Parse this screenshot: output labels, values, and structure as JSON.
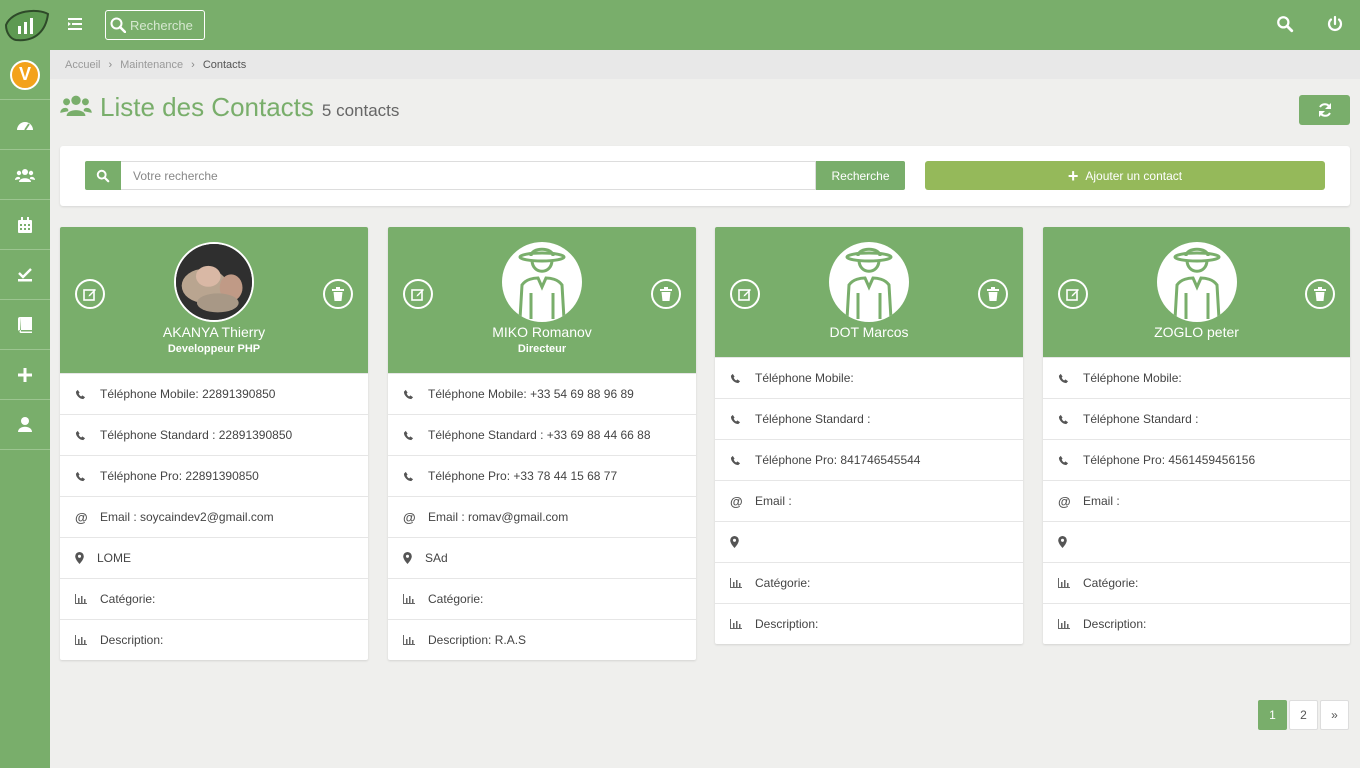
{
  "topbar": {
    "search_placeholder": "Recherche",
    "icons": [
      "menu-icon",
      "search-icon",
      "power-icon"
    ]
  },
  "sidebar": {
    "items": [
      {
        "icon": "logo-v-icon",
        "label": "V"
      },
      {
        "icon": "dashboard-icon"
      },
      {
        "icon": "users-icon"
      },
      {
        "icon": "calendar-icon"
      },
      {
        "icon": "tasks-icon"
      },
      {
        "icon": "book-icon"
      },
      {
        "icon": "plus-icon"
      },
      {
        "icon": "user-icon"
      }
    ]
  },
  "breadcrumb": {
    "items": [
      "Accueil",
      "Maintenance",
      "Contacts"
    ]
  },
  "page": {
    "title": "Liste des Contacts",
    "count": "5 contacts"
  },
  "search": {
    "placeholder": "Votre recherche",
    "button": "Recherche",
    "add_button": "Ajouter un contact"
  },
  "contacts": [
    {
      "name": "AKANYA Thierry",
      "role": "Developpeur PHP",
      "avatar": "photo",
      "mobile": "Téléphone Mobile: 22891390850",
      "standard": "Téléphone Standard : 22891390850",
      "pro": "Téléphone Pro: 22891390850",
      "email": "Email : soycaindev2@gmail.com",
      "location": "LOME",
      "category": "Catégorie:",
      "description": "Description:"
    },
    {
      "name": "MIKO Romanov",
      "role": "Directeur",
      "avatar": "placeholder",
      "mobile": "Téléphone Mobile: +33 54 69 88 96 89",
      "standard": "Téléphone Standard : +33 69 88 44 66 88",
      "pro": "Téléphone Pro: +33 78 44 15 68 77",
      "email": "Email : romav@gmail.com",
      "location": "SAd",
      "category": "Catégorie:",
      "description": "Description: R.A.S"
    },
    {
      "name": "DOT Marcos",
      "role": "",
      "avatar": "placeholder",
      "mobile": "Téléphone Mobile:",
      "standard": "Téléphone Standard :",
      "pro": "Téléphone Pro: 841746545544",
      "email": "Email :",
      "location": "",
      "category": "Catégorie:",
      "description": "Description:"
    },
    {
      "name": "ZOGLO peter",
      "role": "",
      "avatar": "placeholder",
      "mobile": "Téléphone Mobile:",
      "standard": "Téléphone Standard :",
      "pro": "Téléphone Pro: 4561459456156",
      "email": "Email :",
      "location": "",
      "category": "Catégorie:",
      "description": "Description:"
    }
  ],
  "pagination": {
    "pages": [
      "1",
      "2"
    ],
    "next": "»",
    "current": "1"
  },
  "colors": {
    "primary": "#79ae6b",
    "add_button": "#95b95a",
    "logo_badge": "#f3a21b"
  }
}
